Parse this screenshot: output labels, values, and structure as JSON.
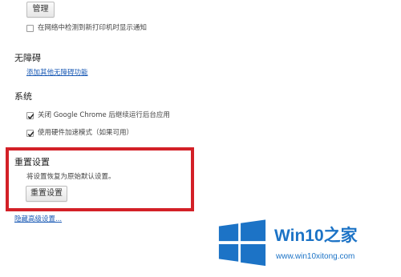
{
  "printers": {
    "manage_button": "管理",
    "notify_checkbox_label": "在网络中检测到新打印机时显示通知",
    "notify_checked": false
  },
  "accessibility": {
    "title": "无障碍",
    "add_link": "添加其他无障碍功能"
  },
  "system": {
    "title": "系统",
    "items": [
      {
        "label": "关闭 Google Chrome 后继续运行后台应用",
        "checked": true
      },
      {
        "label": "使用硬件加速模式（如果可用）",
        "checked": true
      }
    ]
  },
  "reset": {
    "title": "重置设置",
    "description": "将设置恢复为原始默认设置。",
    "button": "重置设置",
    "highlight_color": "#d32027"
  },
  "hide_advanced_link": "隐藏高级设置...",
  "watermark": {
    "brand_prefix": "Win10",
    "brand_suffix": "之家",
    "url": "www.win10xitong.com",
    "color": "#1c73c6"
  }
}
